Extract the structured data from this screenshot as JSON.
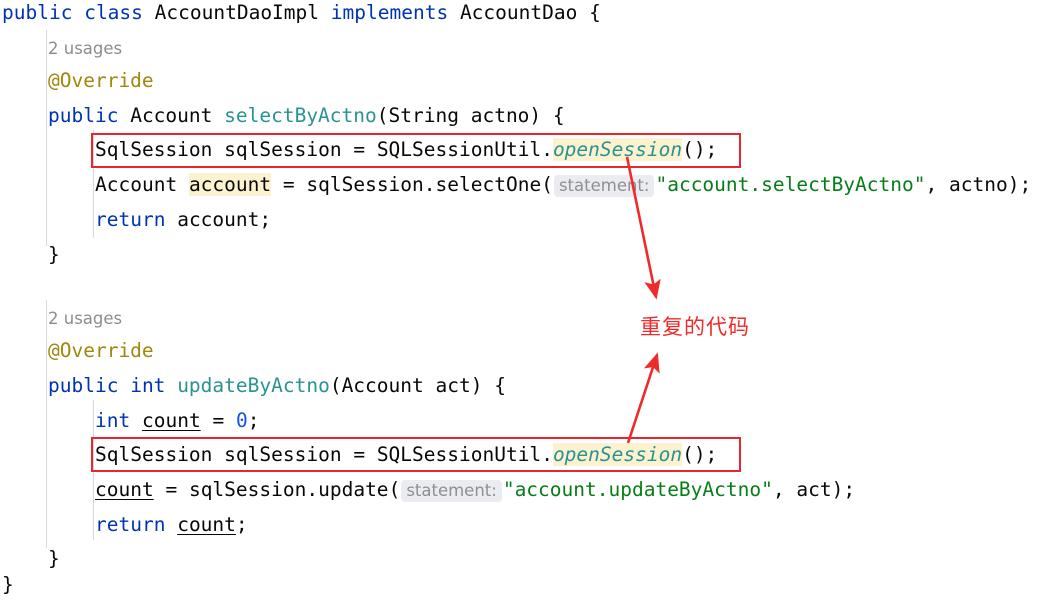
{
  "editor": {
    "language": "java",
    "background": "#ffffff",
    "font_size_px": 19.5,
    "colors": {
      "keyword": "#0033b3",
      "method_name": "#2a9292",
      "annotation": "#9e880d",
      "string": "#067d17",
      "number": "#1750eb",
      "plain_text": "#080808",
      "usages_hint": "#8c8c8c",
      "param_hint_text": "#8d8f96",
      "param_hint_bg": "#ebecf0",
      "identifier_highlight_bg": "#fdf2cf",
      "annotation_red": "#e8262b",
      "note_red": "#ef2a2a",
      "indent_guide": "#d8d8d8"
    }
  },
  "code": {
    "class_decl": {
      "kw_public": "public",
      "kw_class": "class",
      "class_name": "AccountDaoImpl",
      "kw_implements": "implements",
      "interface_name": "AccountDao",
      "brace": "{"
    },
    "method_1": {
      "usages": "2 usages",
      "annotation": "@Override",
      "kw_public": "public",
      "return_type": "Account",
      "name": "selectByActno",
      "paren_open": "(",
      "param_type": "String",
      "param_name": "actno",
      "paren_close": ")",
      "brace": "{",
      "line_session": {
        "type": "SqlSession",
        "var": "sqlSession",
        "eq": "=",
        "util": "SQLSessionUtil",
        "dot": ".",
        "call": "openSession",
        "tail": "();"
      },
      "line_select": {
        "type": "Account",
        "var": "account",
        "eq": "=",
        "receiver": "sqlSession",
        "dot": ".",
        "call": "selectOne",
        "paren_open": "(",
        "hint": "statement:",
        "string": "\"account.selectByActno\"",
        "comma": ",",
        "arg": "actno",
        "tail": ");"
      },
      "line_return": {
        "kw_return": "return",
        "value": "account",
        "semi": ";"
      },
      "close_brace": "}"
    },
    "method_2": {
      "usages": "2 usages",
      "annotation": "@Override",
      "kw_public": "public",
      "return_type": "int",
      "name": "updateByActno",
      "paren_open": "(",
      "param_type": "Account",
      "param_name": "act",
      "paren_close": ")",
      "brace": "{",
      "line_count_init": {
        "kw_int": "int",
        "var": "count",
        "eq": "=",
        "value": "0",
        "semi": ";"
      },
      "line_session": {
        "type": "SqlSession",
        "var": "sqlSession",
        "eq": "=",
        "util": "SQLSessionUtil",
        "dot": ".",
        "call": "openSession",
        "tail": "();"
      },
      "line_update": {
        "var": "count",
        "eq": "=",
        "receiver": "sqlSession",
        "dot": ".",
        "call": "update",
        "paren_open": "(",
        "hint": "statement:",
        "string": "\"account.updateByActno\"",
        "comma": ",",
        "arg": "act",
        "tail": ");"
      },
      "line_return": {
        "kw_return": "return",
        "value": "count",
        "semi": ";"
      },
      "close_brace": "}"
    },
    "class_close_brace": "}"
  },
  "annotations": {
    "note_text": "重复的代码",
    "highlight_boxes": [
      {
        "label": "duplicate-line-1"
      },
      {
        "label": "duplicate-line-2"
      }
    ],
    "arrows": [
      {
        "label": "arrow-from-line-1-to-note"
      },
      {
        "label": "arrow-from-line-2-to-note"
      }
    ]
  }
}
